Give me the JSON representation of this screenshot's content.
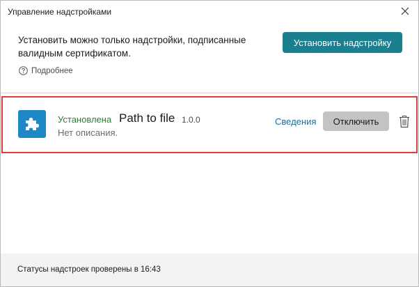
{
  "window": {
    "title": "Управление надстройками"
  },
  "header": {
    "message": "Установить можно только надстройки, подписанные валидным сертификатом.",
    "install_button": "Установить надстройку",
    "more_link": "Подробнее"
  },
  "addins": [
    {
      "status": "Установлена",
      "name": "Path to file",
      "version": "1.0.0",
      "description": "Нет описания.",
      "details_link": "Сведения",
      "disable_button": "Отключить",
      "icon": "puzzle-icon"
    }
  ],
  "footer": {
    "status_text": "Статусы надстроек проверены в 16:43"
  },
  "colors": {
    "accent": "#1a7f8e",
    "installed_status": "#2e7d32",
    "link": "#1a6f95",
    "addin_icon_bg": "#1e88c7",
    "selection_border": "#e23b3b"
  }
}
